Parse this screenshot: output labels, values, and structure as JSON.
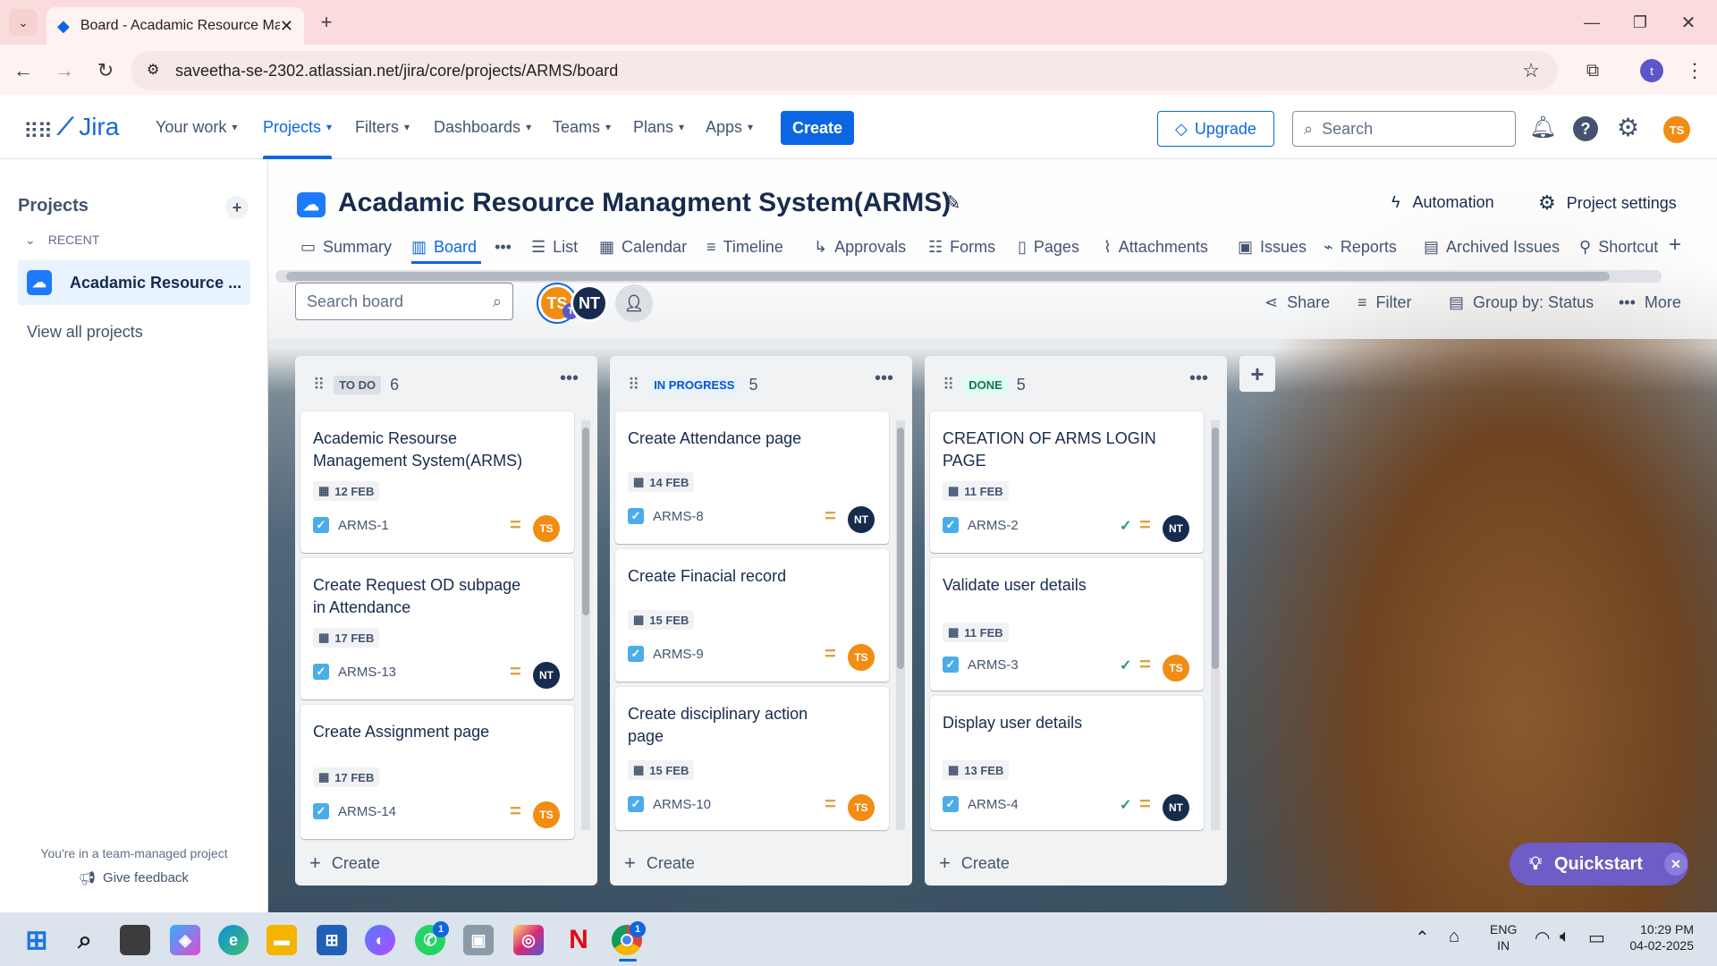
{
  "browser": {
    "tab_title": "Board - Acadamic Resource Ma",
    "url": "saveetha-se-2302.atlassian.net/jira/core/projects/ARMS/board",
    "profile_initial": "t"
  },
  "jira_nav": {
    "logo": "Jira",
    "items": [
      {
        "label": "Your work"
      },
      {
        "label": "Projects"
      },
      {
        "label": "Filters"
      },
      {
        "label": "Dashboards"
      },
      {
        "label": "Teams"
      },
      {
        "label": "Plans"
      },
      {
        "label": "Apps"
      }
    ],
    "create_label": "Create",
    "upgrade_label": "Upgrade",
    "search_placeholder": "Search",
    "user_initials": "TS"
  },
  "sidebar": {
    "heading": "Projects",
    "recent_label": "RECENT",
    "project_name": "Acadamic Resource ...",
    "view_all": "View all projects",
    "team_note": "You're in a team-managed project",
    "feedback": "Give feedback"
  },
  "project": {
    "title": "Acadamic Resource Managment System(ARMS)",
    "automation": "Automation",
    "settings": "Project settings",
    "tabs": [
      {
        "label": "Summary",
        "icon": "summary-icon"
      },
      {
        "label": "Board",
        "icon": "board-icon"
      },
      {
        "label": "List",
        "icon": "list-icon"
      },
      {
        "label": "Calendar",
        "icon": "calendar-icon"
      },
      {
        "label": "Timeline",
        "icon": "timeline-icon"
      },
      {
        "label": "Approvals",
        "icon": "approvals-icon"
      },
      {
        "label": "Forms",
        "icon": "forms-icon"
      },
      {
        "label": "Pages",
        "icon": "pages-icon"
      },
      {
        "label": "Attachments",
        "icon": "attachment-icon"
      },
      {
        "label": "Issues",
        "icon": "issues-icon"
      },
      {
        "label": "Reports",
        "icon": "reports-icon"
      },
      {
        "label": "Archived Issues",
        "icon": "archive-icon"
      },
      {
        "label": "Shortcut",
        "icon": "link-icon"
      }
    ]
  },
  "toolbar": {
    "search_placeholder": "Search board",
    "avatars": [
      "TS",
      "NT"
    ],
    "avatar_badge": "T",
    "share": "Share",
    "filter": "Filter",
    "group_by": "Group by: Status",
    "more": "More"
  },
  "columns": [
    {
      "name": "TO DO",
      "count": "6",
      "cards": [
        {
          "title": "Academic Resourse Management System(ARMS)",
          "date": "12 FEB",
          "key": "ARMS-1",
          "assignee": "TS"
        },
        {
          "title": "Create Request OD subpage in Attendance",
          "date": "17 FEB",
          "key": "ARMS-13",
          "assignee": "NT"
        },
        {
          "title": "Create Assignment page",
          "date": "17 FEB",
          "key": "ARMS-14",
          "assignee": "TS"
        }
      ],
      "create": "Create"
    },
    {
      "name": "IN PROGRESS",
      "count": "5",
      "cards": [
        {
          "title": "Create Attendance page",
          "date": "14 FEB",
          "key": "ARMS-8",
          "assignee": "NT"
        },
        {
          "title": "Create Finacial record",
          "date": "15 FEB",
          "key": "ARMS-9",
          "assignee": "TS"
        },
        {
          "title": "Create disciplinary action page",
          "date": "15 FEB",
          "key": "ARMS-10",
          "assignee": "TS"
        }
      ],
      "create": "Create"
    },
    {
      "name": "DONE",
      "count": "5",
      "cards": [
        {
          "title": "CREATION OF ARMS LOGIN PAGE",
          "date": "11 FEB",
          "key": "ARMS-2",
          "assignee": "NT"
        },
        {
          "title": "Validate user details",
          "date": "11 FEB",
          "key": "ARMS-3",
          "assignee": "TS"
        },
        {
          "title": "Display user details",
          "date": "13 FEB",
          "key": "ARMS-4",
          "assignee": "NT"
        }
      ],
      "create": "Create"
    }
  ],
  "quickstart": "Quickstart",
  "taskbar": {
    "lang": "ENG",
    "region": "IN",
    "time": "10:29 PM",
    "date": "04-02-2025",
    "whatsapp_badge": "1",
    "chrome_badge": "1"
  },
  "colors": {
    "accent": "#0c66e4",
    "assignee_ts": "#f18d13",
    "assignee_nt": "#172b4d",
    "quickstart": "#6e5dc6"
  }
}
